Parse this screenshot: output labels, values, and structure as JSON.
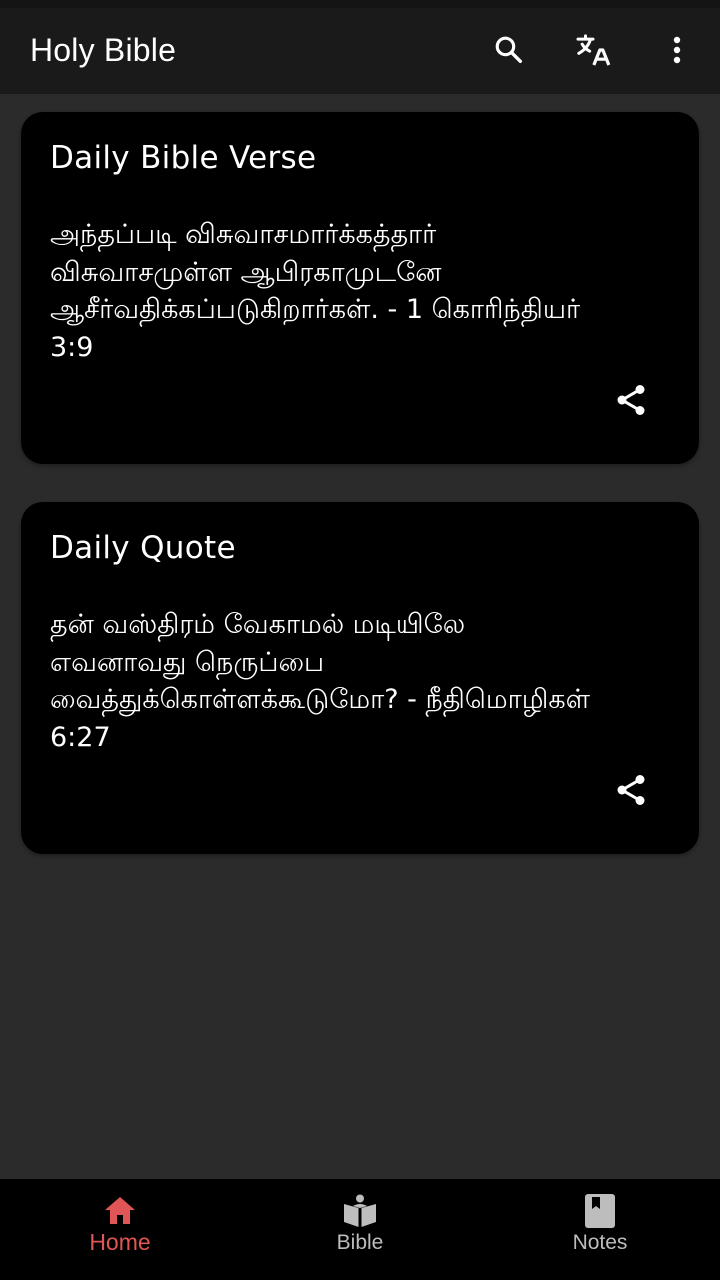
{
  "app_bar": {
    "title": "Holy Bible",
    "actions": [
      {
        "name": "search",
        "icon": "search-icon"
      },
      {
        "name": "translate",
        "icon": "translate-icon"
      },
      {
        "name": "more",
        "icon": "more-vert-icon"
      }
    ]
  },
  "cards": [
    {
      "title": "Daily Bible Verse",
      "body": "அந்தப்படி விசுவாசமார்க்கத்தார் விசுவாசமுள்ள ஆபிரகாமுடனே ஆசீர்வதிக்கப்படுகிறார்கள். - 1 கொரிந்தியர் 3:9",
      "action_icon": "share-icon"
    },
    {
      "title": "Daily Quote",
      "body": "தன் வஸ்திரம் வேகாமல் மடியிலே எவனாவது நெருப்பை வைத்துக்கொள்ளக்கூடுமோ? - நீதிமொழிகள் 6:27",
      "action_icon": "share-icon"
    }
  ],
  "bottom_nav": {
    "items": [
      {
        "label": "Home",
        "icon": "home-icon",
        "active": true
      },
      {
        "label": "Bible",
        "icon": "bible-reader-icon",
        "active": false
      },
      {
        "label": "Notes",
        "icon": "notes-book-icon",
        "active": false
      }
    ],
    "active_color": "#e05555",
    "inactive_color": "#bdbdbd"
  },
  "colors": {
    "background": "#2b2b2b",
    "app_bar": "#1a1a1a",
    "card": "#000000",
    "text": "#ffffff"
  }
}
